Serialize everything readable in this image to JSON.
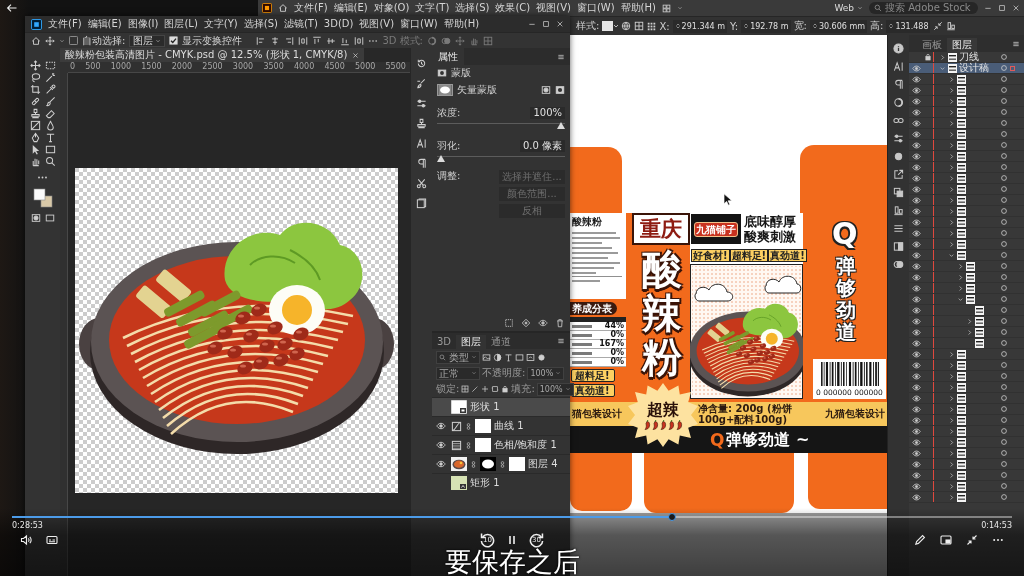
{
  "player": {
    "elapsed": "0:28:53",
    "remaining": "0:14:53",
    "progress": {
      "level": 0.66
    },
    "playing": true,
    "skip_back": "10",
    "skip_forward": "30",
    "subtitle": "要保存之后"
  },
  "photoshop": {
    "menu": [
      "文件(F)",
      "编辑(E)",
      "图像(I)",
      "图层(L)",
      "文字(Y)",
      "选择(S)",
      "滤镜(T)",
      "3D(D)",
      "视图(V)",
      "窗口(W)",
      "帮助(H)"
    ],
    "options": {
      "auto_select": {
        "label": "自动选择:",
        "checked": false
      },
      "target": "图层",
      "transform_controls": {
        "label": "显示变换控件",
        "checked": true
      },
      "mode_3d": "3D 模式:"
    },
    "document_tab": "酸辣粉包装高清图片 - CMYK.psd @ 12.5% (形状 1, CMYK/8)",
    "ruler": [
      "0",
      "500",
      "1000",
      "1500",
      "2000",
      "2500",
      "3000",
      "3500",
      "4000",
      "4500",
      "5000",
      "5500"
    ],
    "properties": {
      "tab": "属性",
      "section": "蒙版",
      "mask": "矢量蒙版",
      "density": {
        "label": "浓度:",
        "value": "100%",
        "level": 1
      },
      "feather": {
        "label": "羽化:",
        "value": "0.0 像素",
        "level": 0
      },
      "adjust_label": "调整:",
      "buttons": [
        {
          "label": "选择并遮住...",
          "disabled": true
        },
        {
          "label": "颜色范围...",
          "disabled": true
        },
        {
          "label": "反相",
          "disabled": true
        }
      ]
    },
    "layers_panel": {
      "tabs": [
        {
          "label": "3D",
          "selected": false
        },
        {
          "label": "图层",
          "selected": true
        },
        {
          "label": "通道",
          "selected": false
        }
      ],
      "filter": "类型",
      "blend_mode": "正常",
      "opacity_label": "不透明度:",
      "opacity": "100%",
      "lock_label": "锁定:",
      "fill_label": "填充:",
      "fill": "100%",
      "layers": [
        {
          "name": "形状 1",
          "kind": "shape",
          "visible": false,
          "selected": true
        },
        {
          "name": "曲线 1",
          "kind": "curves",
          "visible": true,
          "selected": false
        },
        {
          "name": "色相/饱和度 1",
          "kind": "hue_saturation",
          "visible": true,
          "selected": false
        },
        {
          "name": "图层 4",
          "kind": "masked_image",
          "visible": true,
          "selected": false
        },
        {
          "name": "矩形 1",
          "kind": "smart_object",
          "visible": false,
          "selected": false
        }
      ]
    }
  },
  "illustrator": {
    "menu": [
      "文件(F)",
      "编辑(E)",
      "对象(O)",
      "文字(T)",
      "选择(S)",
      "效果(C)",
      "视图(V)",
      "窗口(W)",
      "帮助(H)"
    ],
    "workspace": "Web",
    "search": {
      "placeholder": "搜索 Adobe Stock"
    },
    "control_bar": {
      "style_label": "样式:",
      "fields": [
        {
          "label": "X:",
          "value": "291.344 m"
        },
        {
          "label": "Y:",
          "value": "192.78 m"
        },
        {
          "label": "宽:",
          "value": "30.606 mm"
        },
        {
          "label": "高:",
          "value": "131.488"
        }
      ]
    },
    "layers_panel": {
      "tabs": [
        {
          "label": "画板",
          "selected": false
        },
        {
          "label": "图层",
          "selected": true
        }
      ],
      "layers": [
        {
          "name": "刀线",
          "kind": "group",
          "visible": false,
          "locked": true,
          "expanded": false,
          "selected": false
        },
        {
          "name": "设计稿",
          "kind": "group",
          "visible": true,
          "locked": false,
          "expanded": true,
          "selected": true,
          "children": [
            {
              "kind": "group",
              "visible": true,
              "expanded": false
            },
            {
              "kind": "group",
              "visible": true,
              "expanded": false
            },
            {
              "kind": "group",
              "visible": true,
              "expanded": false
            },
            {
              "kind": "group",
              "visible": true,
              "expanded": false
            },
            {
              "kind": "group",
              "visible": true,
              "expanded": false
            },
            {
              "kind": "group",
              "visible": true,
              "expanded": false
            },
            {
              "kind": "group",
              "visible": true,
              "expanded": false
            },
            {
              "kind": "group",
              "visible": true,
              "expanded": false
            },
            {
              "kind": "group",
              "visible": true,
              "expanded": false
            },
            {
              "kind": "group",
              "visible": true,
              "expanded": false
            },
            {
              "kind": "group",
              "visible": true,
              "expanded": false
            },
            {
              "kind": "group",
              "visible": true,
              "expanded": false
            },
            {
              "kind": "group",
              "visible": true,
              "expanded": false
            },
            {
              "kind": "group",
              "visible": true,
              "expanded": false
            },
            {
              "kind": "group",
              "visible": true,
              "expanded": false
            },
            {
              "kind": "group",
              "visible": true,
              "expanded": false
            },
            {
              "kind": "group",
              "visible": true,
              "expanded": true,
              "children": [
                {
                  "kind": "group",
                  "visible": true,
                  "expanded": false
                },
                {
                  "kind": "group",
                  "visible": true,
                  "expanded": false
                },
                {
                  "kind": "group",
                  "visible": true,
                  "expanded": false
                },
                {
                  "kind": "group",
                  "visible": true,
                  "expanded": true,
                  "children": [
                    {
                      "kind": "path",
                      "visible": true
                    },
                    {
                      "kind": "group",
                      "visible": true,
                      "expanded": false
                    },
                    {
                      "kind": "group",
                      "visible": true,
                      "expanded": false
                    },
                    {
                      "kind": "path",
                      "visible": true
                    }
                  ]
                }
              ]
            },
            {
              "kind": "group",
              "visible": true,
              "expanded": false
            },
            {
              "kind": "group",
              "visible": true,
              "expanded": false
            },
            {
              "kind": "group",
              "visible": true,
              "expanded": false
            },
            {
              "kind": "group",
              "visible": true,
              "expanded": false
            },
            {
              "kind": "group",
              "visible": true,
              "expanded": false
            },
            {
              "kind": "group",
              "visible": true,
              "expanded": false
            },
            {
              "kind": "group",
              "visible": true,
              "expanded": false
            },
            {
              "kind": "group",
              "visible": true,
              "expanded": false
            },
            {
              "kind": "group",
              "visible": true,
              "expanded": false
            },
            {
              "kind": "group",
              "visible": true,
              "expanded": false
            },
            {
              "kind": "group",
              "visible": true,
              "expanded": false
            },
            {
              "kind": "group",
              "visible": true,
              "expanded": false
            },
            {
              "kind": "group",
              "visible": true,
              "expanded": false
            },
            {
              "kind": "group",
              "visible": true,
              "expanded": false
            }
          ]
        }
      ]
    },
    "artboard": {
      "side_panel": {
        "title": "酸辣粉",
        "nutrition_title": "养成分表",
        "nutrition_values": [
          "44%",
          "0%",
          "167%",
          "0%",
          "0%"
        ],
        "badges": [
          "超料足!",
          "真劲道!"
        ]
      },
      "front": {
        "region": "重庆",
        "name": "酸辣粉",
        "spice": "超辣"
      },
      "brand": "九猫铺子",
      "taglines": [
        "底味醇厚",
        "酸爽刺激"
      ],
      "badges": [
        "好食材!",
        "超料足!",
        "真劲道!"
      ],
      "back": {
        "mark": "Q",
        "slogan": "弹够劲道",
        "barcode_number": "0 000000 000000"
      },
      "strip": {
        "left": "猫包装设计",
        "center": "净含量: 200g (粉饼100g+配料100g)",
        "right": "九猫包装设计"
      },
      "band": {
        "mark": "Q",
        "slogan": "弹够劲道 ~"
      }
    }
  }
}
